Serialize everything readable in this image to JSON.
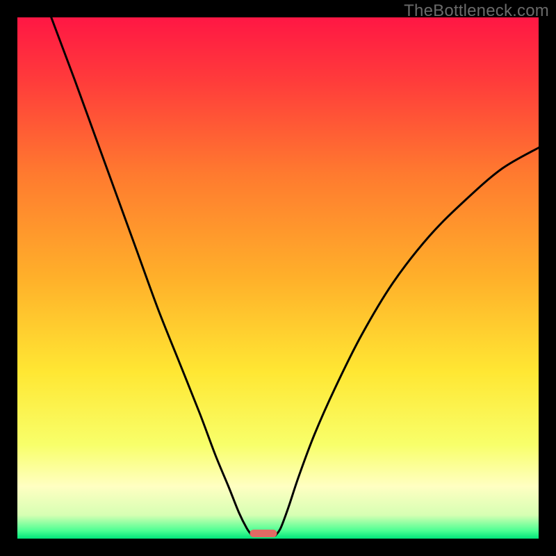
{
  "watermark": "TheBottleneck.com",
  "chart_data": {
    "type": "line",
    "title": "",
    "xlabel": "",
    "ylabel": "",
    "xlim": [
      0,
      100
    ],
    "ylim": [
      0,
      100
    ],
    "grid": false,
    "legend": false,
    "background_gradient_stops": [
      {
        "offset": 0.0,
        "color": "#ff1744"
      },
      {
        "offset": 0.12,
        "color": "#ff3b3b"
      },
      {
        "offset": 0.3,
        "color": "#ff7a2f"
      },
      {
        "offset": 0.5,
        "color": "#ffb02a"
      },
      {
        "offset": 0.68,
        "color": "#ffe733"
      },
      {
        "offset": 0.82,
        "color": "#f8ff6a"
      },
      {
        "offset": 0.9,
        "color": "#ffffc2"
      },
      {
        "offset": 0.955,
        "color": "#d6ffb3"
      },
      {
        "offset": 0.985,
        "color": "#4bff93"
      },
      {
        "offset": 1.0,
        "color": "#00e47a"
      }
    ],
    "series": [
      {
        "name": "left-curve",
        "stroke": "#000000",
        "points": [
          {
            "x": 6.5,
            "y": 100.0
          },
          {
            "x": 8.0,
            "y": 96.0
          },
          {
            "x": 11.0,
            "y": 88.0
          },
          {
            "x": 15.0,
            "y": 77.0
          },
          {
            "x": 19.0,
            "y": 66.0
          },
          {
            "x": 23.0,
            "y": 55.0
          },
          {
            "x": 27.0,
            "y": 44.0
          },
          {
            "x": 31.0,
            "y": 34.0
          },
          {
            "x": 35.0,
            "y": 24.0
          },
          {
            "x": 38.0,
            "y": 16.0
          },
          {
            "x": 40.5,
            "y": 10.0
          },
          {
            "x": 42.5,
            "y": 5.0
          },
          {
            "x": 44.0,
            "y": 2.0
          },
          {
            "x": 45.0,
            "y": 0.6
          }
        ]
      },
      {
        "name": "right-curve",
        "stroke": "#000000",
        "points": [
          {
            "x": 49.5,
            "y": 0.6
          },
          {
            "x": 50.5,
            "y": 2.0
          },
          {
            "x": 52.0,
            "y": 6.0
          },
          {
            "x": 54.0,
            "y": 12.0
          },
          {
            "x": 57.0,
            "y": 20.0
          },
          {
            "x": 61.0,
            "y": 29.0
          },
          {
            "x": 66.0,
            "y": 39.0
          },
          {
            "x": 72.0,
            "y": 49.0
          },
          {
            "x": 79.0,
            "y": 58.0
          },
          {
            "x": 86.0,
            "y": 65.0
          },
          {
            "x": 93.0,
            "y": 71.0
          },
          {
            "x": 100.0,
            "y": 75.0
          }
        ]
      }
    ],
    "marker": {
      "name": "bottleneck-marker",
      "x_center": 47.2,
      "width": 5.2,
      "y": 0.0,
      "fill": "#e26a64"
    }
  }
}
